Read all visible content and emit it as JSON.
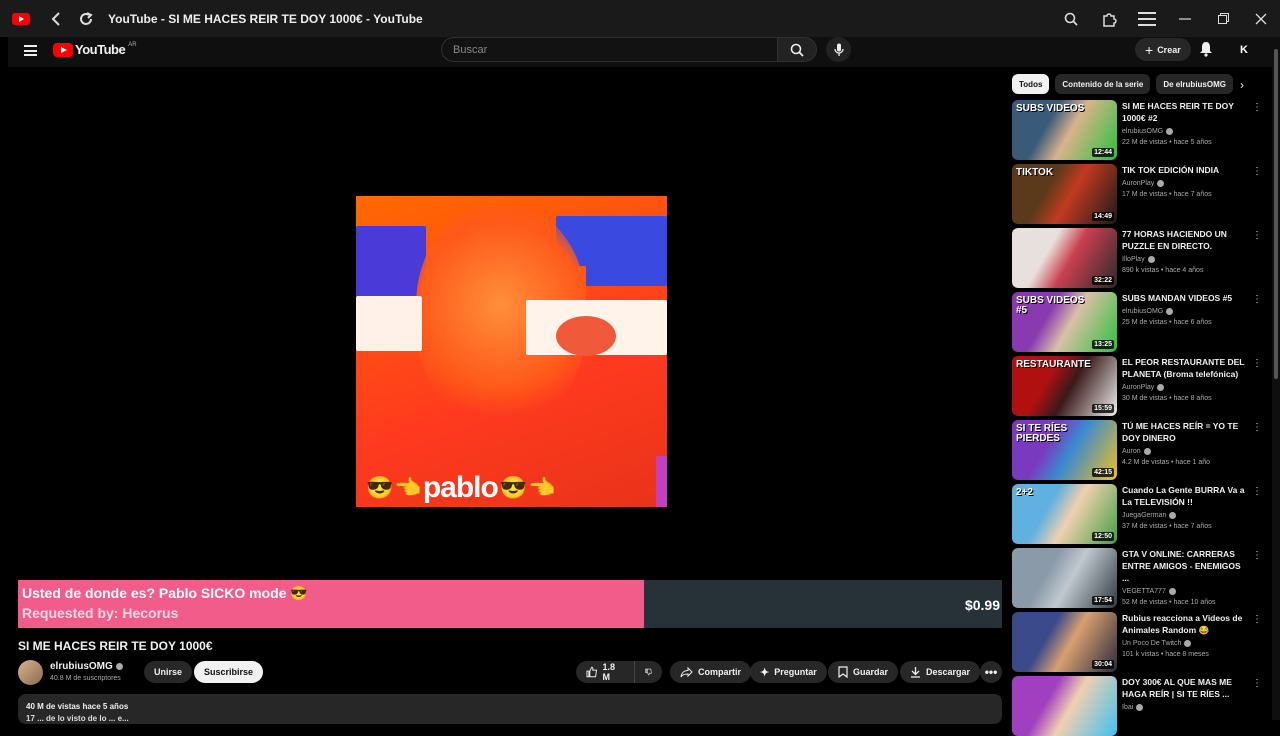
{
  "window": {
    "title": "YouTube - SI ME HACES REIR TE DOY 1000€ - YouTube"
  },
  "header": {
    "logo_text": "YouTube",
    "logo_region": "AR",
    "search_placeholder": "Buscar",
    "create_label": "Crear",
    "avatar_letter": "K"
  },
  "player": {
    "overlay_caption": "pablo",
    "donation": {
      "message": "Usted de donde es? Pablo SICKO mode 😎",
      "requested_by": "Requested by: Hecorus",
      "amount": "$0.99",
      "progress": 0.636
    }
  },
  "video": {
    "title": "SI ME HACES REIR TE DOY 1000€",
    "channel": "elrubiusOMG",
    "subscribers": "40.8 M de suscriptores",
    "join_label": "Unirse",
    "subscribe_label": "Suscribirse",
    "likes": "1.8 M",
    "share_label": "Compartir",
    "ask_label": "Preguntar",
    "save_label": "Guardar",
    "download_label": "Descargar",
    "stats": "40 M de vistas  hace 5 años",
    "desc_line2": "17 ... de lo visto de lo ... e..."
  },
  "chips": [
    "Todos",
    "Contenido de la serie",
    "De elrubiusOMG"
  ],
  "recommendations": [
    {
      "title": "SI ME HACES REIR TE DOY 1000€ #2",
      "channel": "elrubiusOMG",
      "views": "22 M de vistas • hace 5 años",
      "duration": "12:44",
      "colors": [
        "#3a5a7a",
        "#d9b38c",
        "#28c23a"
      ],
      "thumb_text": "SUBS VIDEOS"
    },
    {
      "title": "TIK TOK EDICIÓN INDIA",
      "channel": "AuronPlay",
      "views": "17 M de vistas • hace 7 años",
      "duration": "14:49",
      "colors": [
        "#5a3a1a",
        "#c23a20",
        "#1a1a1a"
      ],
      "thumb_text": "TIKTOK"
    },
    {
      "title": "77 HORAS HACIENDO UN PUZZLE EN DIRECTO.",
      "channel": "IlloPlay",
      "views": "890 k vistas • hace 4 años",
      "duration": "32:22",
      "colors": [
        "#e8e0dc",
        "#c94050",
        "#2a2a2a"
      ],
      "thumb_text": ""
    },
    {
      "title": "SUBS MANDAN VIDEOS #5",
      "channel": "elrubiusOMG",
      "views": "25 M de vistas • hace 6 años",
      "duration": "13:25",
      "colors": [
        "#8a3ab0",
        "#d9c0a8",
        "#28c23a"
      ],
      "thumb_text": "SUBS VIDEOS #5"
    },
    {
      "title": "EL PEOR RESTAURANTE DEL PLANETA (Broma telefónica)",
      "channel": "AuronPlay",
      "views": "30 M de vistas • hace 8 años",
      "duration": "15:59",
      "colors": [
        "#b01010",
        "#3a1a1a",
        "#f0f0f0"
      ],
      "thumb_text": "RESTAURANTE"
    },
    {
      "title": "TÚ ME HACES REÍR = YO TE DOY DINERO",
      "channel": "Auron",
      "views": "4.2 M de vistas • hace 1 año",
      "duration": "42:15",
      "colors": [
        "#7a3ac0",
        "#3a8ad0",
        "#f0c020"
      ],
      "thumb_text": "SI TE RÍES PIERDES"
    },
    {
      "title": "Cuando La Gente BURRA Va a La TELEVISIÓN !!",
      "channel": "JuegaGerman",
      "views": "37 M de vistas • hace 7 años",
      "duration": "12:50",
      "colors": [
        "#60b0e0",
        "#f0d0b0",
        "#40a040"
      ],
      "thumb_text": "2+2"
    },
    {
      "title": "GTA V ONLINE: CARRERAS ENTRE AMIGOS - ENEMIGOS ...",
      "channel": "VEGETTA777",
      "views": "52 M de vistas • hace 10 años",
      "duration": "17:54",
      "colors": [
        "#8a9aa8",
        "#c0c8d0",
        "#303a40"
      ],
      "thumb_text": ""
    },
    {
      "title": "Rubius reacciona a Videos de Animales Random 😂",
      "channel": "Un Poco De Twitch",
      "views": "101 k vistas • hace 8 meses",
      "duration": "30:04",
      "colors": [
        "#3a4a8a",
        "#d9a070",
        "#2a2a3a"
      ],
      "thumb_text": ""
    },
    {
      "title": "DOY 300€ AL QUE MAS ME HAGA REÍR | SI TE RÍES ...",
      "channel": "Ibai",
      "views": "",
      "duration": "",
      "colors": [
        "#a040c0",
        "#f0d0b0",
        "#40c0f0"
      ],
      "thumb_text": ""
    }
  ]
}
